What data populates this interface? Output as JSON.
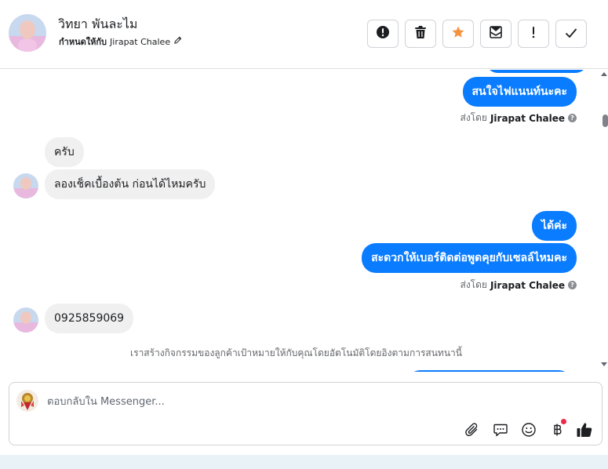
{
  "header": {
    "contact_name": "วิทยา พันละไม",
    "assigned_prefix": "กำหนดให้กับ",
    "assigned_to": "Jirapat Chalee",
    "actions": [
      {
        "name": "mark-spam-button",
        "icon": "alert-circle-icon"
      },
      {
        "name": "delete-button",
        "icon": "trash-icon"
      },
      {
        "name": "star-button",
        "icon": "star-icon"
      },
      {
        "name": "mark-unread-button",
        "icon": "envelope-icon"
      },
      {
        "name": "follow-up-button",
        "icon": "exclamation-icon"
      },
      {
        "name": "mark-done-button",
        "icon": "checkmark-icon"
      }
    ]
  },
  "conversation": {
    "messages": [
      {
        "direction": "out",
        "text": "สนใจไฟแนนท์นะคะ"
      },
      {
        "direction": "in",
        "text": "ครับ"
      },
      {
        "direction": "in",
        "text": "ลองเช็คเบื้องต้น ก่อนได้ไหมครับ"
      },
      {
        "direction": "out",
        "text": "ได้ค่ะ"
      },
      {
        "direction": "out",
        "text": "สะดวกให้เบอร์ติดต่อพูดคุยกับเซลล์ไหมคะ"
      },
      {
        "direction": "in",
        "text": "0925859069"
      }
    ],
    "sent_by_prefix": "ส่งโดย",
    "sent_by_name": "Jirapat Chalee",
    "system_note": "เราสร้างกิจกรรมของลูกค้าเป้าหมายให้กับคุณโดยอัตโนมัติโดยอิงตามการสนทนานี้"
  },
  "composer": {
    "placeholder": "ตอบกลับใน Messenger...",
    "icons": [
      "paperclip-icon",
      "saved-reply-icon",
      "emoji-icon",
      "baht-payment-icon",
      "thumbs-up-icon"
    ]
  },
  "colors": {
    "outgoing_bubble": "#0a7cff",
    "incoming_bubble": "#f0f0f0",
    "star_accent": "#f5923e",
    "notification_dot": "#f02849"
  }
}
